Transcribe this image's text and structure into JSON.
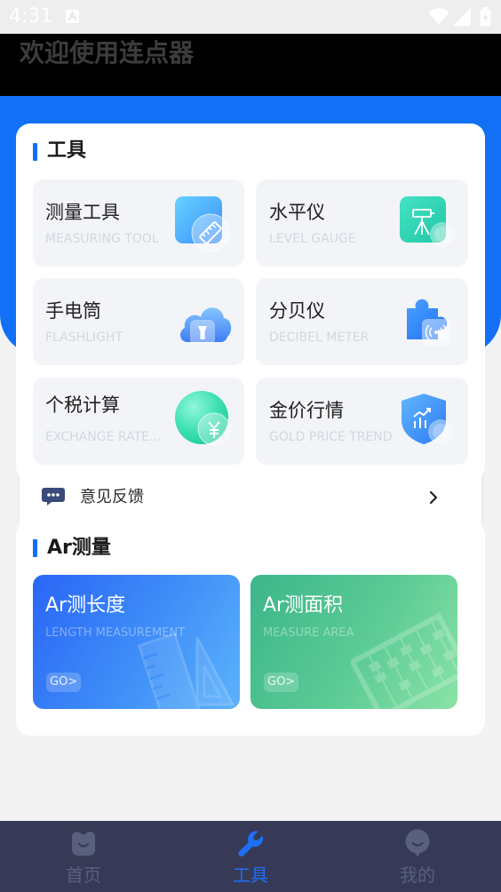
{
  "status_bar": {
    "time": "4:31"
  },
  "header": {
    "title": "欢迎使用连点器"
  },
  "tools": {
    "title": "工具",
    "items": [
      {
        "title": "测量工具",
        "subtitle": "MEASURING TOOL",
        "icon": "ruler-icon"
      },
      {
        "title": "水平仪",
        "subtitle": "LEVEL GAUGE",
        "icon": "level-tripod-icon"
      },
      {
        "title": "手电筒",
        "subtitle": "FLASHLIGHT",
        "icon": "flashlight-cloud-icon"
      },
      {
        "title": "分贝仪",
        "subtitle": "DECIBEL METER",
        "icon": "decibel-puzzle-icon"
      },
      {
        "title": "个税计算",
        "subtitle": "EXCHANGE RATE...",
        "icon": "yuan-coin-icon"
      },
      {
        "title": "金价行情",
        "subtitle": "GOLD PRICE TREND",
        "icon": "shield-chart-icon"
      }
    ]
  },
  "feedback": {
    "label": "意见反馈",
    "icon": "chat-bubble-icon"
  },
  "ar": {
    "title": "Ar测量",
    "cards": [
      {
        "title": "Ar测长度",
        "subtitle": "LENGTH MEASUREMENT",
        "go": "GO>"
      },
      {
        "title": "Ar测面积",
        "subtitle": "MEASURE AREA",
        "go": "GO>"
      }
    ]
  },
  "nav": {
    "items": [
      {
        "label": "首页",
        "icon": "home-icon",
        "active": false
      },
      {
        "label": "工具",
        "icon": "wrench-icon",
        "active": true
      },
      {
        "label": "我的",
        "icon": "profile-icon",
        "active": false
      }
    ]
  },
  "colors": {
    "accent": "#1170f6",
    "header_bg": "#000000",
    "nav_bg": "#363a56",
    "nav_inactive": "#58607e"
  }
}
